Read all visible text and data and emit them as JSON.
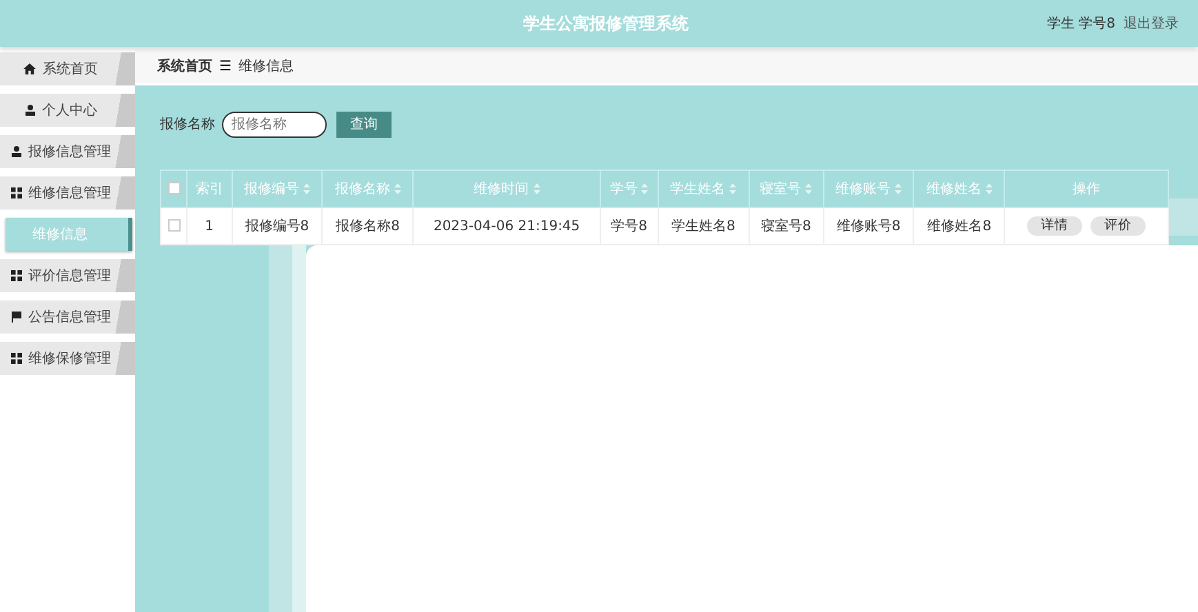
{
  "header": {
    "title": "学生公寓报修管理系统",
    "user": "学生 学号8",
    "logout": "退出登录"
  },
  "sidebar": {
    "items": [
      {
        "label": "系统首页",
        "selected": false
      },
      {
        "label": "个人中心",
        "selected": false
      },
      {
        "label": "报修信息管理",
        "selected": false
      },
      {
        "label": "维修信息管理",
        "selected": false,
        "expanded": true,
        "children": [
          {
            "label": "维修信息",
            "selected": true
          }
        ]
      },
      {
        "label": "评价信息管理",
        "selected": false
      },
      {
        "label": "公告信息管理",
        "selected": false
      },
      {
        "label": "维修保修管理",
        "selected": false
      }
    ]
  },
  "breadcrumb": {
    "items": [
      "系统首页",
      "维修信息"
    ],
    "separator": "☰"
  },
  "search": {
    "label": "报修名称",
    "placeholder": "报修名称",
    "button": "查询"
  },
  "table": {
    "select_all": {
      "checked": false
    },
    "columns": [
      {
        "label": "索引",
        "sortable": false
      },
      {
        "label": "报修编号",
        "sortable": true
      },
      {
        "label": "报修名称",
        "sortable": true
      },
      {
        "label": "维修时间",
        "sortable": true
      },
      {
        "label": "学号",
        "sortable": true
      },
      {
        "label": "学生姓名",
        "sortable": true
      },
      {
        "label": "寝室号",
        "sortable": true
      },
      {
        "label": "维修账号",
        "sortable": true
      },
      {
        "label": "维修姓名",
        "sortable": true
      },
      {
        "label": "操作",
        "sortable": false
      }
    ],
    "rows": [
      {
        "checked": false,
        "cells": [
          "1",
          "报修编号8",
          "报修名称8",
          "2023-04-06 21:19:45",
          "学号8",
          "学生姓名8",
          "寝室号8",
          "维修账号8",
          "维修姓名8"
        ],
        "actions": [
          "详情",
          "评价"
        ]
      }
    ]
  }
}
